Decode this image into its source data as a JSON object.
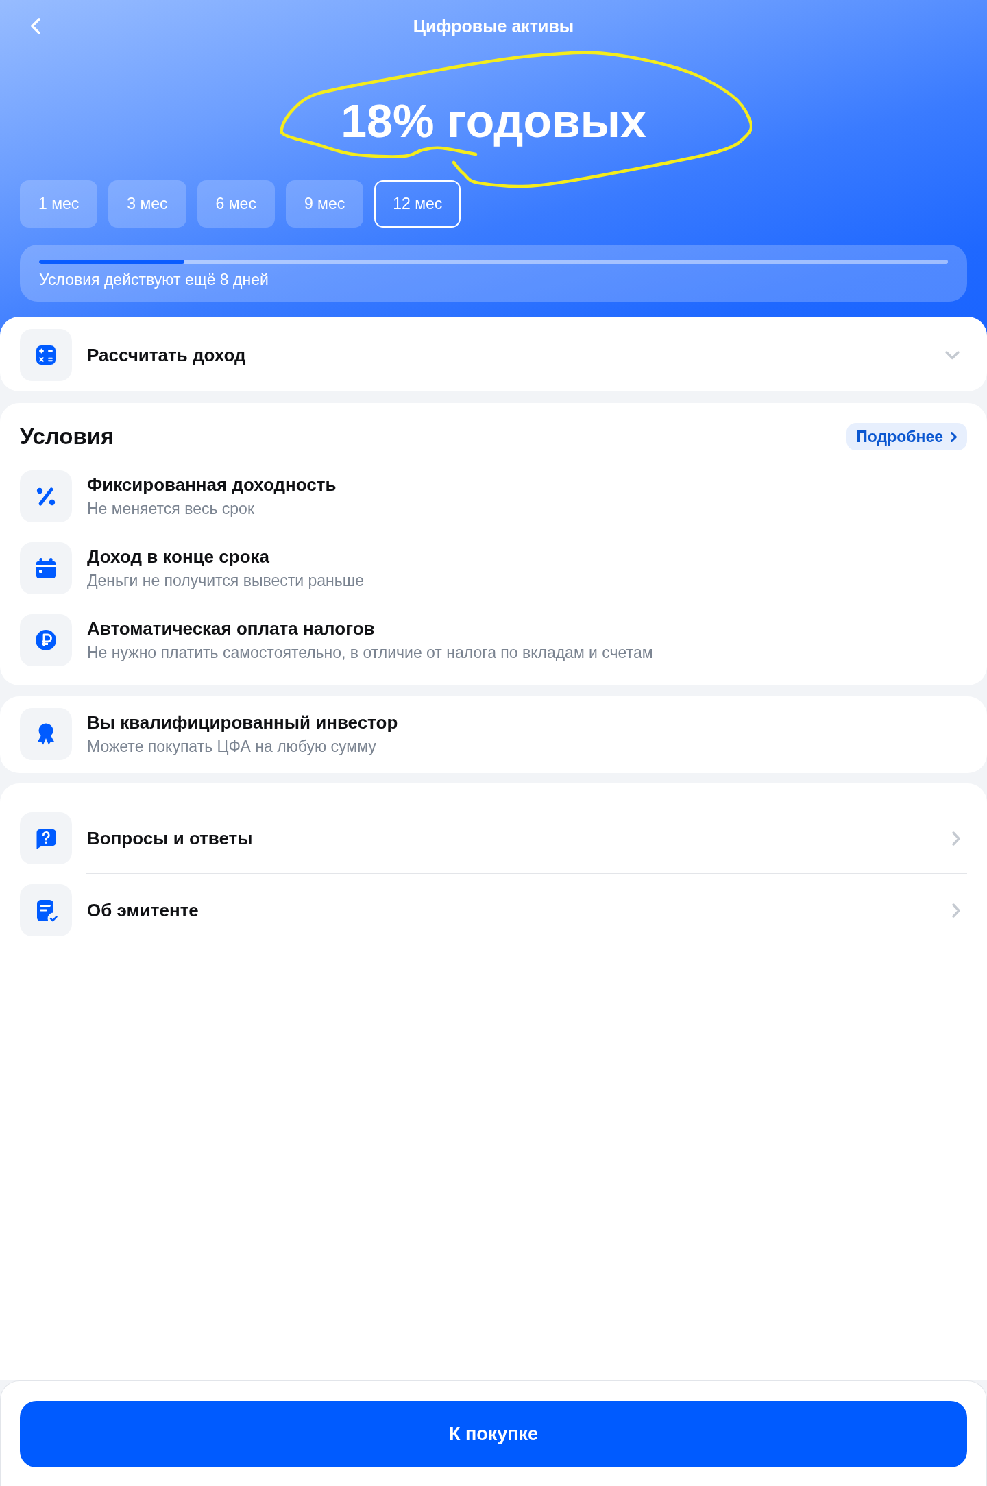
{
  "header": {
    "title": "Цифровые активы",
    "rate": {
      "text": "18% годовых",
      "circled": true
    }
  },
  "terms": [
    {
      "label": "1 мес",
      "selected": false
    },
    {
      "label": "3 мес",
      "selected": false
    },
    {
      "label": "6 мес",
      "selected": false
    },
    {
      "label": "9 мес",
      "selected": false
    },
    {
      "label": "12 мес",
      "selected": true
    }
  ],
  "offer": {
    "level": 0.16,
    "caption": "Условия действуют ещё 8 дней"
  },
  "calculator": {
    "label": "Рассчитать доход",
    "expanded": false
  },
  "conditions": {
    "title": "Условия",
    "more_link": "Подробнее",
    "items": [
      {
        "title": "Фиксированная доходность",
        "subtitle": "Не меняется весь срок"
      },
      {
        "title": "Доход в конце срока",
        "subtitle": "Деньги не получится вывести раньше"
      },
      {
        "title": "Автоматическая оплата налогов",
        "subtitle": "Не нужно платить самостоятельно, в отличие от налога по вкладам и счетам"
      }
    ]
  },
  "investor_status": {
    "title": "Вы квалифицированный инвестор",
    "subtitle": "Можете покупать ЦФА на любую сумму"
  },
  "links": [
    {
      "label": "Вопросы и ответы"
    },
    {
      "label": "Об эмитенте"
    }
  ],
  "action_button": {
    "label": "К покупке"
  }
}
